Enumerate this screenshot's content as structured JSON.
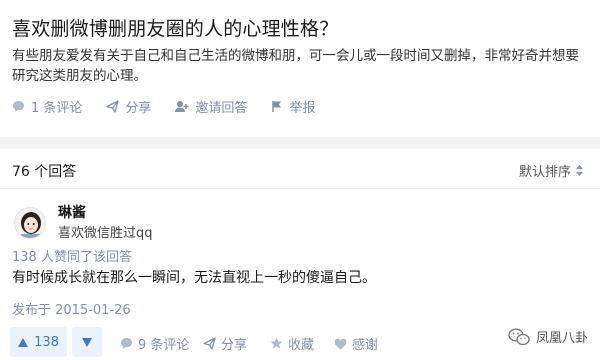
{
  "question": {
    "title": "喜欢删微博删朋友圈的人的心理性格？",
    "description": "有些朋友爱发有关于自己和自己生活的微博和朋，可一会儿或一段时间又删掉，非常好奇并想要研究这类朋友的心理。",
    "actions": {
      "comments": "1 条评论",
      "share": "分享",
      "invite": "邀请回答",
      "report": "举报"
    }
  },
  "answers_header": {
    "count": "76 个回答",
    "sort_label": "默认排序"
  },
  "answer": {
    "author_name": "琳酱",
    "author_bio": "喜欢微信胜过qq",
    "vote_info": "138 人赞同了该回答",
    "text": "有时候成长就在那么一瞬间，无法直视上一秒的傻逼自己。",
    "published": "发布于 2015-01-26",
    "actions": {
      "upvote_count": "138",
      "comments": "9 条评论",
      "share": "分享",
      "favorite": "收藏",
      "thanks": "感谢"
    }
  },
  "watermark": {
    "text": "凤凰八卦"
  },
  "colors": {
    "accent": "#3e7ac2",
    "muted": "#8590a6",
    "upvote_bg": "#eaf2fb",
    "band": "#f3f3f3"
  },
  "icons": {
    "comment": "comment-bubble-icon",
    "share": "share-plane-icon",
    "invite": "invite-user-icon",
    "report": "flag-icon",
    "sort": "sort-arrows-icon",
    "upvote": "triangle-up-icon",
    "downvote": "triangle-down-icon",
    "favorite": "star-icon",
    "thanks": "heart-icon"
  }
}
